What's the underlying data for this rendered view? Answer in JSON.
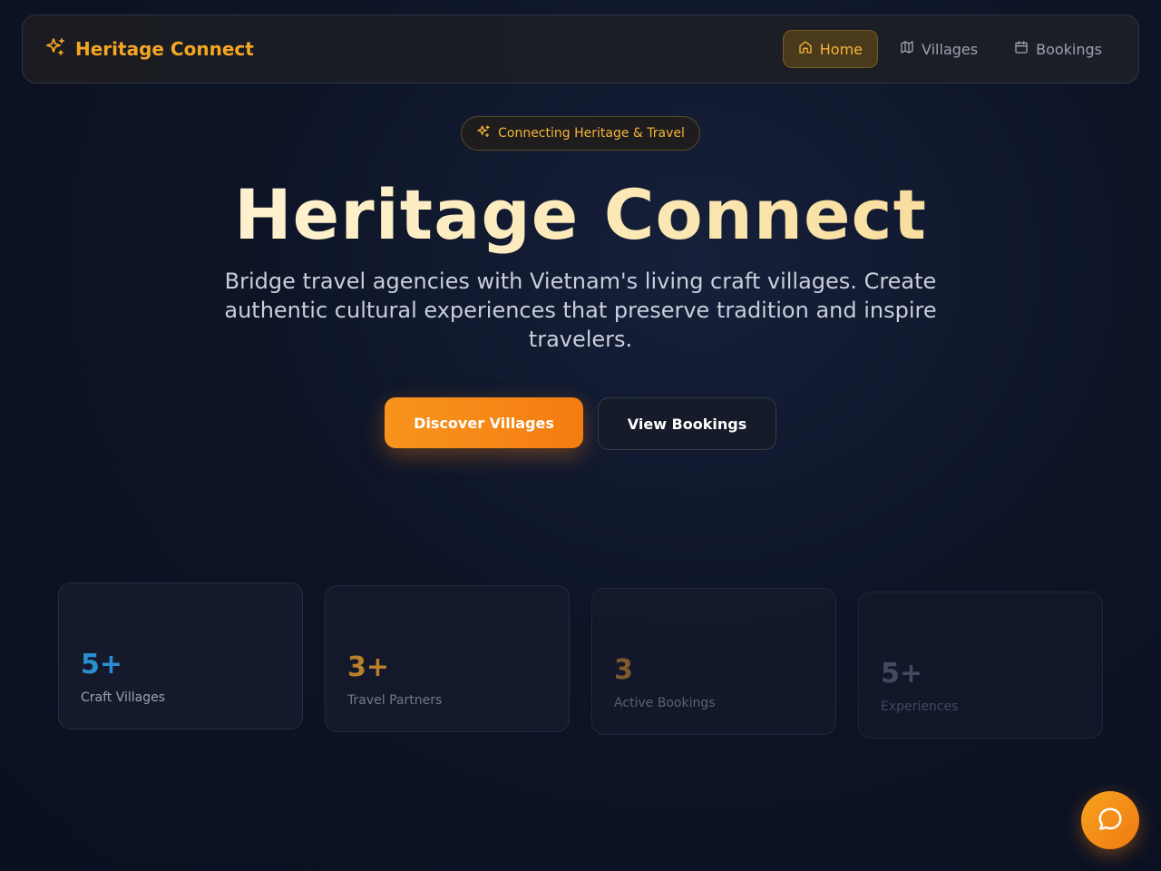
{
  "brand": {
    "name": "Heritage Connect",
    "icon": "sparkles-icon",
    "color": "#f5a623"
  },
  "nav": {
    "items": [
      {
        "label": "Home",
        "icon": "home-icon",
        "active": true
      },
      {
        "label": "Villages",
        "icon": "map-icon",
        "active": false
      },
      {
        "label": "Bookings",
        "icon": "calendar-icon",
        "active": false
      }
    ]
  },
  "hero": {
    "badge": "Connecting Heritage & Travel",
    "title": "Heritage Connect",
    "subtitle": "Bridge travel agencies with Vietnam's living craft villages. Create authentic cultural experiences that preserve tradition and inspire travelers.",
    "primary_cta": "Discover Villages",
    "secondary_cta": "View Bookings"
  },
  "stats": [
    {
      "value": "5+",
      "label": "Craft Villages",
      "color": "#2a8fd0"
    },
    {
      "value": "3+",
      "label": "Travel Partners",
      "color": "#c88a2a"
    },
    {
      "value": "3",
      "label": "Active Bookings",
      "color": "#9a6a32"
    },
    {
      "value": "5+",
      "label": "Experiences",
      "color": "#5a6276"
    }
  ],
  "chat": {
    "icon": "chat-bubble-icon"
  },
  "colors": {
    "accent": "#f5a623",
    "background": "#0d1426",
    "primary_button": "#f7941d"
  }
}
